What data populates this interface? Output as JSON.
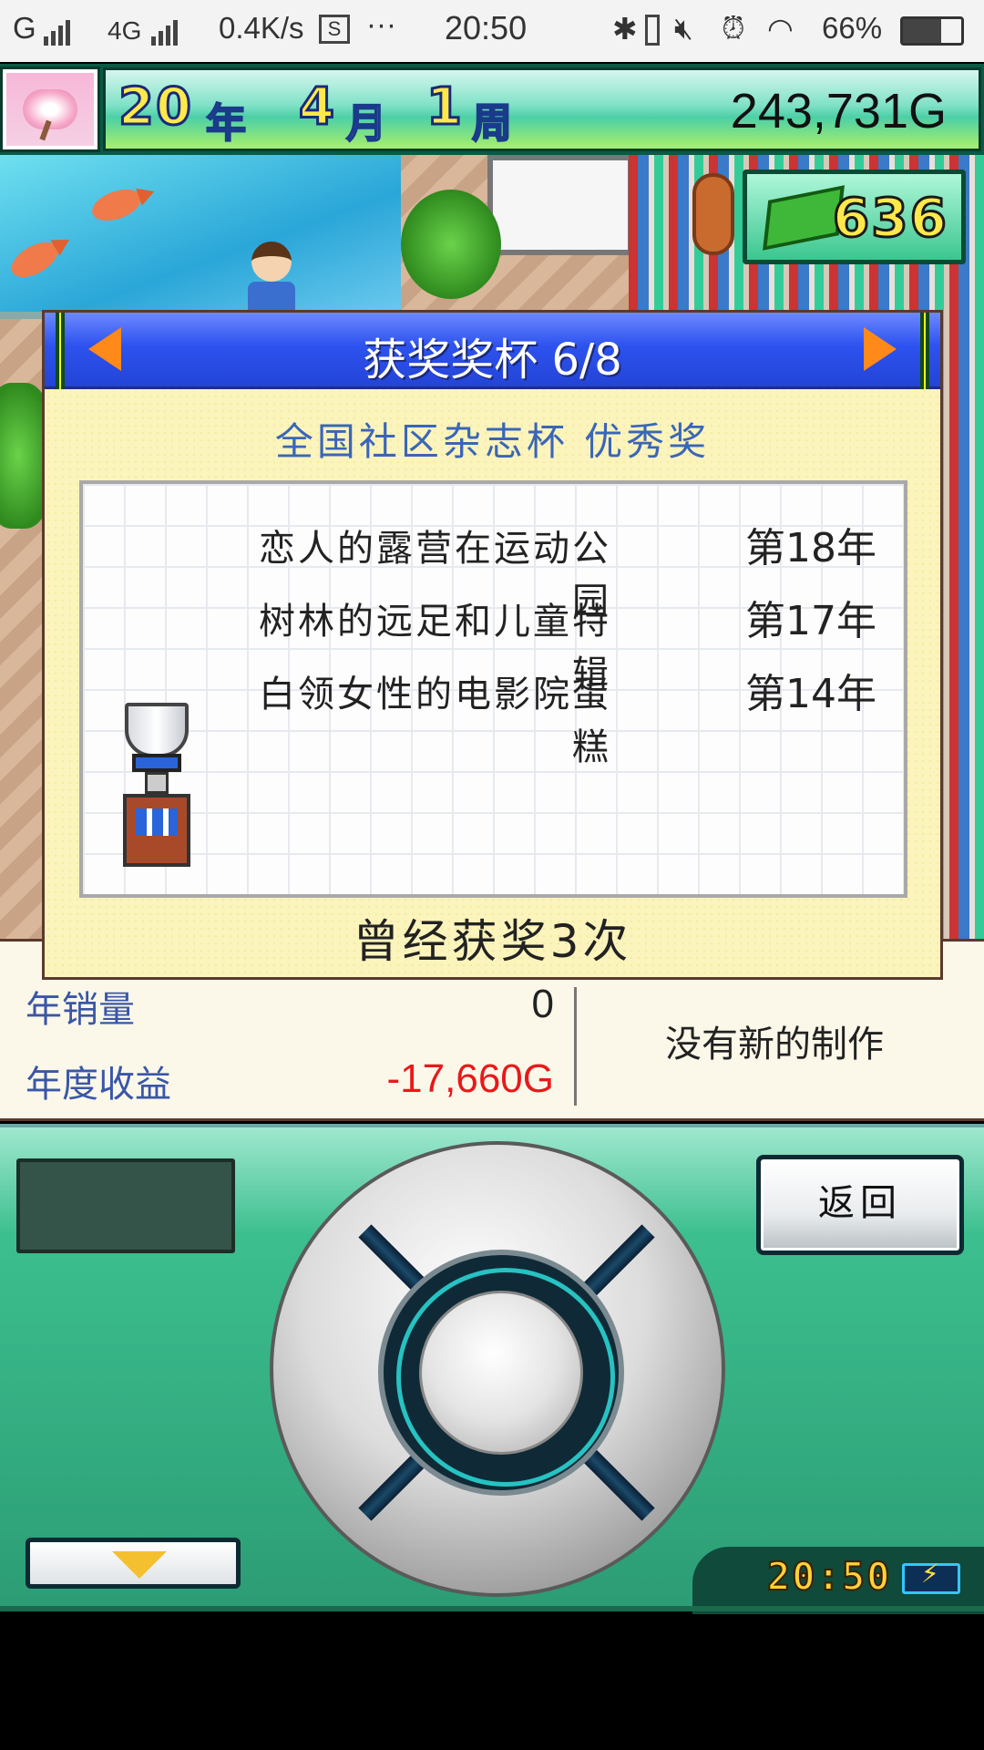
{
  "status_bar": {
    "carrier": "G",
    "network": "4G",
    "speed": "0.4K/s",
    "more": "···",
    "time": "20:50",
    "battery": "66%"
  },
  "header": {
    "year": "20",
    "year_unit": "年",
    "month": "4",
    "month_unit": "月",
    "week": "1",
    "week_unit": "周",
    "money": "243,731G"
  },
  "books": {
    "count": "636"
  },
  "dialog": {
    "title": "获奖奖杯 6/8",
    "award_name": "全国社区杂志杯 优秀奖",
    "winners": [
      {
        "title": "恋人的露营在运动公园",
        "year": "第18年"
      },
      {
        "title": "树林的远足和儿童特辑",
        "year": "第17年"
      },
      {
        "title": "白领女性的电影院蛋糕",
        "year": "第14年"
      }
    ],
    "win_count": "曾经获奖3次"
  },
  "stats": {
    "sales_label": "年销量",
    "sales_value": "0",
    "profit_label": "年度收益",
    "profit_value": "-17,660G",
    "profit_color": "#e8191a",
    "production_status": "没有新的制作"
  },
  "controls": {
    "back_label": "返回",
    "clock": "20:50"
  }
}
